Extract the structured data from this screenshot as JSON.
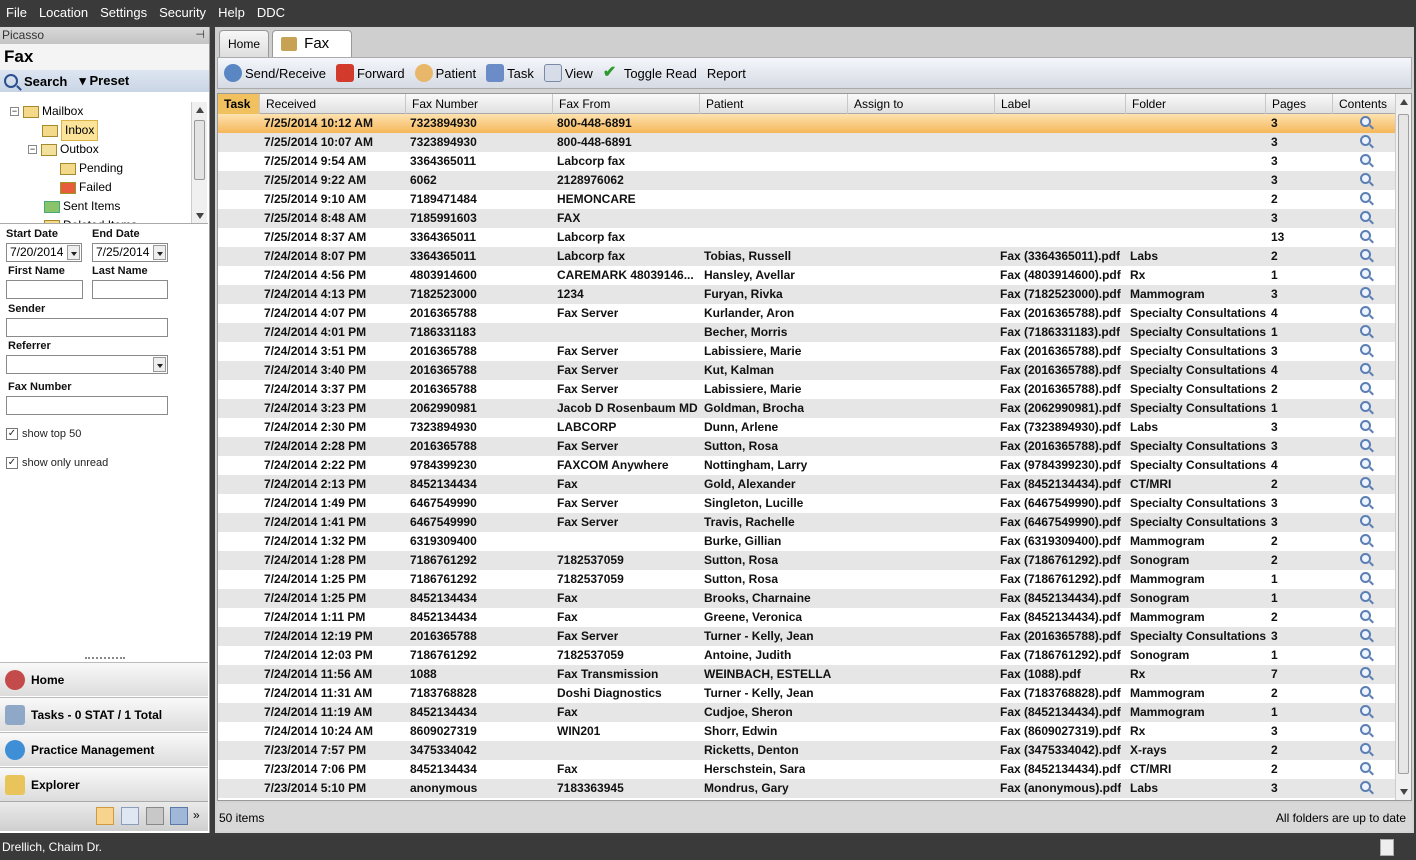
{
  "menu": [
    "File",
    "Location",
    "Settings",
    "Security",
    "Help",
    "DDC"
  ],
  "left": {
    "panel_title": "Picasso",
    "section_title": "Fax",
    "search_label": "Search",
    "preset_label": "Preset",
    "tree": [
      {
        "label": "Mailbox"
      },
      {
        "label": "Inbox"
      },
      {
        "label": "Outbox"
      },
      {
        "label": "Pending"
      },
      {
        "label": "Failed"
      },
      {
        "label": "Sent Items"
      },
      {
        "label": "Deleted Items"
      }
    ],
    "start_date_label": "Start Date",
    "start_date": "7/20/2014",
    "end_date_label": "End Date",
    "end_date": "7/25/2014",
    "first_name_label": "First Name",
    "last_name_label": "Last Name",
    "sender_label": "Sender",
    "referrer_label": "Referrer",
    "fax_number_label": "Fax Number",
    "show_top_label": "show top 50",
    "show_unread_label": "show only unread",
    "nav": {
      "home": "Home",
      "tasks": "Tasks - 0 STAT / 1 Total",
      "practice": "Practice Management",
      "explorer": "Explorer"
    }
  },
  "tabs": {
    "home": "Home",
    "fax": "Fax"
  },
  "toolbar": {
    "send_receive": "Send/Receive",
    "forward": "Forward",
    "patient": "Patient",
    "task": "Task",
    "view": "View",
    "toggle_read": "Toggle Read",
    "report": "Report"
  },
  "grid": {
    "columns": [
      "Task",
      "Received",
      "Fax Number",
      "Fax From",
      "Patient",
      "Assign to",
      "Label",
      "Folder",
      "Pages",
      "Contents"
    ],
    "rows": [
      [
        "",
        "7/25/2014 10:12 AM",
        "7323894930",
        "800-448-6891",
        "",
        "",
        "",
        "",
        "3"
      ],
      [
        "",
        "7/25/2014 10:07 AM",
        "7323894930",
        "800-448-6891",
        "",
        "",
        "",
        "",
        "3"
      ],
      [
        "",
        "7/25/2014 9:54 AM",
        "3364365011",
        "Labcorp fax",
        "",
        "",
        "",
        "",
        "3"
      ],
      [
        "",
        "7/25/2014 9:22 AM",
        "6062",
        "2128976062",
        "",
        "",
        "",
        "",
        "3"
      ],
      [
        "",
        "7/25/2014 9:10 AM",
        "7189471484",
        "HEMONCARE",
        "",
        "",
        "",
        "",
        "2"
      ],
      [
        "",
        "7/25/2014 8:48 AM",
        "7185991603",
        "FAX",
        "",
        "",
        "",
        "",
        "3"
      ],
      [
        "",
        "7/25/2014 8:37 AM",
        "3364365011",
        "Labcorp fax",
        "",
        "",
        "",
        "",
        "13"
      ],
      [
        "",
        "7/24/2014 8:07 PM",
        "3364365011",
        "Labcorp fax",
        "Tobias, Russell",
        "",
        "Fax (3364365011).pdf",
        "Labs",
        "2"
      ],
      [
        "",
        "7/24/2014 4:56 PM",
        "4803914600",
        "CAREMARK 48039146...",
        "Hansley, Avellar",
        "",
        "Fax (4803914600).pdf",
        "Rx",
        "1"
      ],
      [
        "",
        "7/24/2014 4:13 PM",
        "7182523000",
        "1234",
        "Furyan, Rivka",
        "",
        "Fax (7182523000).pdf",
        "Mammogram",
        "3"
      ],
      [
        "",
        "7/24/2014 4:07 PM",
        "2016365788",
        "Fax Server",
        "Kurlander, Aron",
        "",
        "Fax (2016365788).pdf",
        "Specialty Consultations",
        "4"
      ],
      [
        "",
        "7/24/2014 4:01 PM",
        "7186331183",
        "",
        "Becher, Morris",
        "",
        "Fax (7186331183).pdf",
        "Specialty Consultations",
        "1"
      ],
      [
        "",
        "7/24/2014 3:51 PM",
        "2016365788",
        "Fax Server",
        "Labissiere, Marie",
        "",
        "Fax (2016365788).pdf",
        "Specialty Consultations",
        "3"
      ],
      [
        "",
        "7/24/2014 3:40 PM",
        "2016365788",
        "Fax Server",
        "Kut, Kalman",
        "",
        "Fax (2016365788).pdf",
        "Specialty Consultations",
        "4"
      ],
      [
        "",
        "7/24/2014 3:37 PM",
        "2016365788",
        "Fax Server",
        "Labissiere, Marie",
        "",
        "Fax (2016365788).pdf",
        "Specialty Consultations",
        "2"
      ],
      [
        "",
        "7/24/2014 3:23 PM",
        "2062990981",
        "Jacob D Rosenbaum MD",
        "Goldman, Brocha",
        "",
        "Fax (2062990981).pdf",
        "Specialty Consultations",
        "1"
      ],
      [
        "",
        "7/24/2014 2:30 PM",
        "7323894930",
        "LABCORP",
        "Dunn, Arlene",
        "",
        "Fax (7323894930).pdf",
        "Labs",
        "3"
      ],
      [
        "",
        "7/24/2014 2:28 PM",
        "2016365788",
        "Fax Server",
        "Sutton, Rosa",
        "",
        "Fax (2016365788).pdf",
        "Specialty Consultations",
        "3"
      ],
      [
        "",
        "7/24/2014 2:22 PM",
        "9784399230",
        "FAXCOM Anywhere",
        "Nottingham, Larry",
        "",
        "Fax (9784399230).pdf",
        "Specialty Consultations",
        "4"
      ],
      [
        "",
        "7/24/2014 2:13 PM",
        "8452134434",
        "Fax",
        "Gold, Alexander",
        "",
        "Fax (8452134434).pdf",
        "CT/MRI",
        "2"
      ],
      [
        "",
        "7/24/2014 1:49 PM",
        "6467549990",
        "Fax Server",
        "Singleton, Lucille",
        "",
        "Fax (6467549990).pdf",
        "Specialty Consultations",
        "3"
      ],
      [
        "",
        "7/24/2014 1:41 PM",
        "6467549990",
        "Fax Server",
        "Travis, Rachelle",
        "",
        "Fax (6467549990).pdf",
        "Specialty Consultations",
        "3"
      ],
      [
        "",
        "7/24/2014 1:32 PM",
        "6319309400",
        "",
        "Burke, Gillian",
        "",
        "Fax (6319309400).pdf",
        "Mammogram",
        "2"
      ],
      [
        "",
        "7/24/2014 1:28 PM",
        "7186761292",
        "7182537059",
        "Sutton, Rosa",
        "",
        "Fax (7186761292).pdf",
        "Sonogram",
        "2"
      ],
      [
        "",
        "7/24/2014 1:25 PM",
        "7186761292",
        "7182537059",
        "Sutton, Rosa",
        "",
        "Fax (7186761292).pdf",
        "Mammogram",
        "1"
      ],
      [
        "",
        "7/24/2014 1:25 PM",
        "8452134434",
        "Fax",
        "Brooks, Charnaine",
        "",
        "Fax (8452134434).pdf",
        "Sonogram",
        "1"
      ],
      [
        "",
        "7/24/2014 1:11 PM",
        "8452134434",
        "Fax",
        "Greene, Veronica",
        "",
        "Fax (8452134434).pdf",
        "Mammogram",
        "2"
      ],
      [
        "",
        "7/24/2014 12:19 PM",
        "2016365788",
        "Fax Server",
        "Turner - Kelly, Jean",
        "",
        "Fax (2016365788).pdf",
        "Specialty Consultations",
        "3"
      ],
      [
        "",
        "7/24/2014 12:03 PM",
        "7186761292",
        "7182537059",
        "Antoine, Judith",
        "",
        "Fax (7186761292).pdf",
        "Sonogram",
        "1"
      ],
      [
        "",
        "7/24/2014 11:56 AM",
        "1088",
        "Fax Transmission",
        "WEINBACH, ESTELLA",
        "",
        "Fax (1088).pdf",
        "Rx",
        "7"
      ],
      [
        "",
        "7/24/2014 11:31 AM",
        "7183768828",
        "Doshi Diagnostics",
        "Turner - Kelly, Jean",
        "",
        "Fax (7183768828).pdf",
        "Mammogram",
        "2"
      ],
      [
        "",
        "7/24/2014 11:19 AM",
        "8452134434",
        "Fax",
        "Cudjoe, Sheron",
        "",
        "Fax (8452134434).pdf",
        "Mammogram",
        "1"
      ],
      [
        "",
        "7/24/2014 10:24 AM",
        "8609027319",
        "WIN201",
        "Shorr, Edwin",
        "",
        "Fax (8609027319).pdf",
        "Rx",
        "3"
      ],
      [
        "",
        "7/23/2014 7:57 PM",
        "3475334042",
        "",
        "Ricketts, Denton",
        "",
        "Fax (3475334042).pdf",
        "X-rays",
        "2"
      ],
      [
        "",
        "7/23/2014 7:06 PM",
        "8452134434",
        "Fax",
        "Herschstein, Sara",
        "",
        "Fax (8452134434).pdf",
        "CT/MRI",
        "2"
      ],
      [
        "",
        "7/23/2014 5:10 PM",
        "anonymous",
        "7183363945",
        "Mondrus, Gary",
        "",
        "Fax (anonymous).pdf",
        "Labs",
        "3"
      ]
    ]
  },
  "status": {
    "items": "50 items",
    "sync": "All folders are up to date"
  },
  "user": "Drellich, Chaim Dr.",
  "colors": {
    "accent": "#f2c15f",
    "selected_row": "#f6b75a"
  }
}
